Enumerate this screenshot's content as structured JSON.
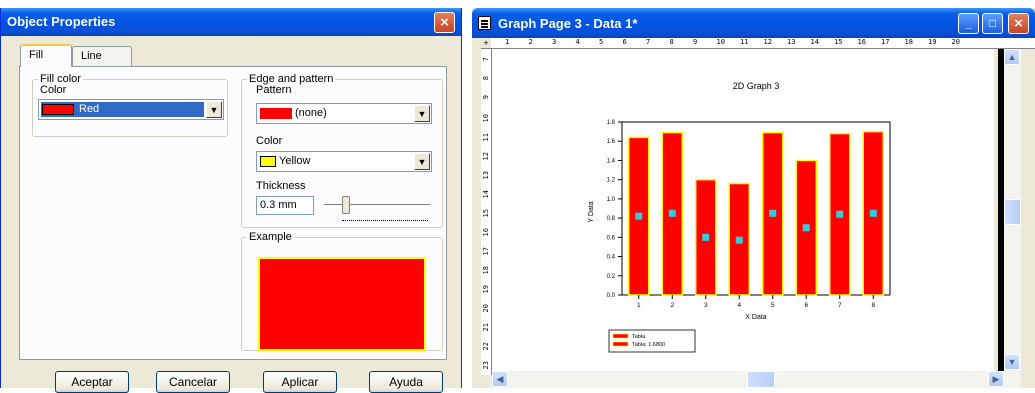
{
  "dialog": {
    "title": "Object Properties",
    "close_glyph": "×",
    "tabs": [
      {
        "label": "Fill"
      },
      {
        "label": "Line"
      }
    ],
    "fill_color": {
      "group_label": "Fill color",
      "color_label": "Color",
      "color_value": "Red",
      "swatch": "#ff0000"
    },
    "edge": {
      "group_label": "Edge and pattern",
      "pattern_label": "Pattern",
      "pattern_value": "(none)",
      "pattern_swatch": "#ff0000",
      "color_label": "Color",
      "color_value": "Yellow",
      "color_swatch": "#ffff00",
      "thickness_label": "Thickness",
      "thickness_value": "0.3 mm"
    },
    "example": {
      "label": "Example",
      "fill": "#ff0000",
      "border": "#ffff00"
    },
    "buttons": {
      "ok": "Aceptar",
      "cancel": "Cancelar",
      "apply": "Aplicar",
      "help": "Ayuda"
    }
  },
  "graph_window": {
    "title": "Graph Page 3 - Data 1*",
    "controls": {
      "minimize": "_",
      "maximize": "□",
      "close": "×"
    },
    "ruler_corner": "+",
    "hruler_numbers": [
      "1",
      "2",
      "3",
      "4",
      "5",
      "6",
      "7",
      "8",
      "9",
      "10",
      "11",
      "12",
      "13",
      "14",
      "15",
      "16",
      "17",
      "18",
      "19",
      "20"
    ],
    "vruler_numbers": [
      "7",
      "8",
      "9",
      "10",
      "11",
      "12",
      "13",
      "14",
      "15",
      "16",
      "17",
      "18",
      "19",
      "20",
      "21",
      "22",
      "23"
    ],
    "scroll": {
      "up": "▲",
      "down": "▼",
      "left": "◀",
      "right": "▶"
    }
  },
  "chart_data": {
    "type": "bar",
    "title": "2D Graph 3",
    "xlabel": "X Data",
    "ylabel": "Y Data",
    "ylim": [
      0,
      1.8
    ],
    "yticks": [
      "0.0",
      "0.2",
      "0.4",
      "0.6",
      "0.8",
      "1.0",
      "1.2",
      "1.4",
      "1.6",
      "1.8"
    ],
    "categories": [
      "1",
      "2",
      "3",
      "4",
      "5",
      "6",
      "7",
      "8"
    ],
    "series": [
      {
        "name": "Tabla",
        "type": "bar",
        "values": [
          1.64,
          1.69,
          1.2,
          1.16,
          1.69,
          1.4,
          1.68,
          1.7
        ],
        "color": "#ff0000",
        "edge": "#ffff00"
      },
      {
        "name": "Tabla: 1.6800",
        "type": "scatter",
        "values": [
          0.82,
          0.85,
          0.6,
          0.57,
          0.85,
          0.7,
          0.84,
          0.85
        ],
        "color": "#33ccdd"
      }
    ],
    "legend": {
      "position": "bottom-left",
      "entries": [
        "Tabla",
        "Tabla: 1.6800"
      ]
    },
    "grid": false
  }
}
